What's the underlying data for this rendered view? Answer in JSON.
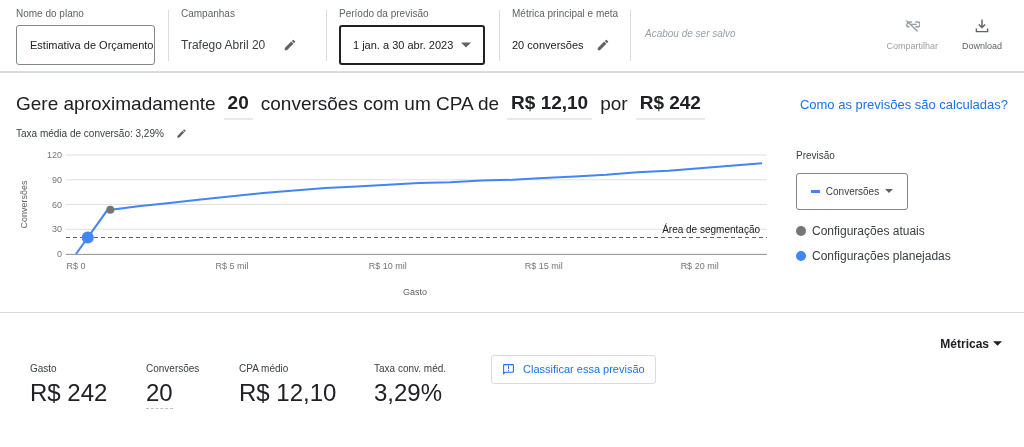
{
  "header": {
    "fields": [
      {
        "kind": "input",
        "label": "Nome do plano",
        "value": "Estimativa de Orçamento"
      },
      {
        "kind": "edit",
        "label": "Campanhas",
        "value": "Trafego Abril 20"
      },
      {
        "kind": "select",
        "label": "Período da previsão",
        "value": "1 jan. a 30 abr. 2023"
      },
      {
        "kind": "edit",
        "label": "Métrica principal e meta",
        "value": "20 conversões"
      }
    ],
    "save_status": "Acabou de ser salvo",
    "actions": [
      {
        "kind": "share",
        "label": "Compartilhar",
        "disabled": true
      },
      {
        "kind": "download",
        "label": "Download",
        "disabled": false
      }
    ]
  },
  "headline": [
    {
      "kind": "text",
      "text": "Gere aproximadamente"
    },
    {
      "kind": "value",
      "text": "20"
    },
    {
      "kind": "text",
      "text": "conversões com um CPA de"
    },
    {
      "kind": "value",
      "text": "R$ 12,10"
    },
    {
      "kind": "text",
      "text": "por"
    },
    {
      "kind": "value",
      "text": "R$ 242"
    }
  ],
  "help_link": "Como as previsões são calculadas?",
  "conversion_rate": "Taxa média de conversão: 3,29%",
  "chart": {
    "chart_data": {
      "type": "line",
      "xlabel": "Gasto",
      "ylabel": "Conversões",
      "categories": [
        "R$ 0",
        null,
        null,
        null,
        null,
        "R$ 5 mil",
        null,
        null,
        null,
        null,
        "R$ 10 mil",
        null,
        null,
        null,
        null,
        "R$ 15 mil",
        null,
        null,
        null,
        null,
        "R$ 20 mil",
        null,
        null
      ],
      "grid": true,
      "series": [
        {
          "color": "#4285f4",
          "values": [
            0,
            53,
            58,
            62,
            66,
            70,
            74,
            77,
            80,
            82,
            84,
            86,
            87,
            89,
            90,
            92,
            94,
            96,
            99,
            101,
            104,
            107,
            110
          ]
        }
      ],
      "ylim": [
        0,
        120
      ],
      "yticks": [
        0,
        30,
        60,
        90,
        120
      ],
      "ref_lines": [
        {
          "axis": "y",
          "value": 20,
          "label": "Área de segmentação"
        }
      ]
    }
  },
  "legend": {
    "title": "Previsão",
    "dropdown": "Conversões",
    "items": [
      {
        "label": "Configurações atuais",
        "color": "#757575"
      },
      {
        "label": "Configurações planejadas",
        "color": "#4285f4"
      }
    ]
  },
  "metrics_menu": "Métricas",
  "metrics": [
    {
      "label": "Gasto",
      "value": "R$ 242",
      "editable": false
    },
    {
      "label": "Conversões",
      "value": "20",
      "editable": true
    },
    {
      "label": "CPA médio",
      "value": "R$ 12,10",
      "editable": false
    },
    {
      "label": "Taxa conv. méd.",
      "value": "3,29%",
      "editable": false
    }
  ],
  "feedback_button": "Classificar essa previsão"
}
